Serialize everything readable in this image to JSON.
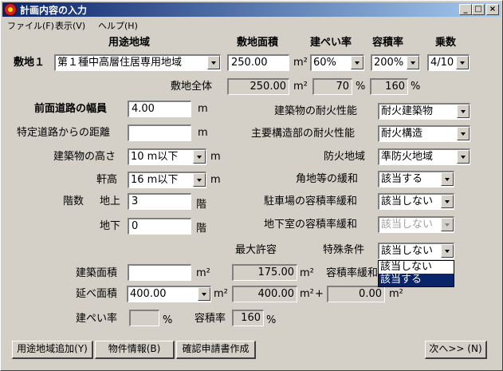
{
  "window": {
    "title": "計画内容の入力",
    "min": "_",
    "max": "□",
    "close": "×"
  },
  "menu": [
    "ファイル(F)",
    "表示(V)",
    "ヘルプ(H)"
  ],
  "headers": {
    "youto": "用途地域",
    "menseki": "敷地面積",
    "kenpei": "建ぺい率",
    "youseki": "容積率",
    "jousu": "乗数"
  },
  "site": {
    "label": "敷地１",
    "youto": "第１種中高層住居専用地域",
    "area": "250.00",
    "area_unit": "m²",
    "kenpei": "60%",
    "youseki": "200%",
    "jousu": "4/10"
  },
  "whole": {
    "label": "敷地全体",
    "area": "250.00",
    "area_unit": "m²",
    "kenpei": "70",
    "kenpei_unit": "%",
    "youseki": "160",
    "youseki_unit": "%"
  },
  "road": {
    "label": "前面道路の幅員",
    "value": "4.00",
    "unit": "m"
  },
  "special_road": {
    "label": "特定道路からの距離",
    "value": "",
    "unit": "m"
  },
  "height": {
    "label": "建築物の高さ",
    "value": "10 m以下",
    "unit": "m"
  },
  "eaves": {
    "label": "軒高",
    "value": "16 m以下",
    "unit": "m"
  },
  "floors": {
    "label": "階数",
    "above_label": "地上",
    "above": "3",
    "below_label": "地下",
    "below": "0",
    "unit": "階"
  },
  "right": {
    "fire_building": {
      "label": "建築物の耐火性能",
      "value": "耐火建築物"
    },
    "fire_struct": {
      "label": "主要構造部の耐火性能",
      "value": "耐火構造"
    },
    "fire_zone": {
      "label": "防火地域",
      "value": "準防火地域"
    },
    "corner": {
      "label": "角地等の緩和",
      "value": "該当する"
    },
    "parking": {
      "label": "駐車場の容積率緩和",
      "value": "該当しない"
    },
    "basement": {
      "label": "地下室の容積率緩和",
      "value": "該当しない"
    },
    "special": {
      "label": "特殊条件",
      "value": "該当しない",
      "options": [
        "該当しない",
        "該当する"
      ]
    }
  },
  "max_label": "最大許容",
  "building_area": {
    "label": "建築面積",
    "value": "",
    "unit": "m²",
    "max": "175.00",
    "max_unit": "m²"
  },
  "floor_area": {
    "label": "延べ面積",
    "value": "400.00",
    "unit": "m²",
    "max": "400.00",
    "max_unit": "m²",
    "plus": "+",
    "relax_label": "容積率緩和",
    "relax": "0.00",
    "relax_unit": "m²"
  },
  "result": {
    "kenpei_label": "建ぺい率",
    "kenpei": "",
    "kenpei_unit": "%",
    "youseki_label": "容積率",
    "youseki": "160",
    "youseki_unit": "%"
  },
  "buttons": {
    "add": "用途地域追加(Y)",
    "info": "物件情報(B)",
    "form": "確認申請書作成",
    "next": "次へ>> (N)"
  }
}
